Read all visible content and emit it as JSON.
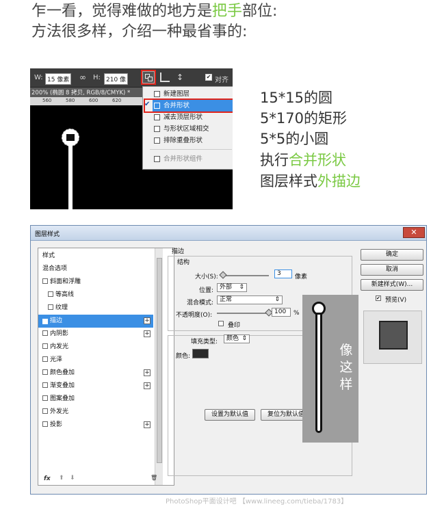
{
  "intro": {
    "line1_prefix": "乍一看，觉得难做的地方是",
    "line1_highlight": "把手",
    "line1_suffix": "部位:",
    "line2": "方法很多样，介绍一种最省事的:"
  },
  "ps_screenshot": {
    "toolbar": {
      "w_label": "W:",
      "w_value": "15 像素",
      "h_label": "H:",
      "h_value": "210 像",
      "link_glyph": "∞",
      "align_label": "对齐"
    },
    "tab_title": "200% (椭圆 8 拷贝, RGB/8/CMYK) *",
    "ruler_numbers": [
      "560",
      "580",
      "600",
      "620"
    ],
    "menu_items": [
      {
        "label": "新建图层",
        "state": "normal"
      },
      {
        "label": "合并形状",
        "state": "selected"
      },
      {
        "label": "减去顶层形状",
        "state": "normal"
      },
      {
        "label": "与形状区域相交",
        "state": "normal"
      },
      {
        "label": "排除重叠形状",
        "state": "normal"
      },
      {
        "label": "合并形状组件",
        "state": "disabled"
      }
    ],
    "check_glyph": "✔"
  },
  "steps": {
    "s1": "15*15的圆",
    "s2": "5*170的矩形",
    "s3": "5*5的小圆",
    "s4_prefix": "执行",
    "s4_highlight": "合并形状",
    "s5_prefix": "图层样式",
    "s5_highlight": "外描边"
  },
  "dialog": {
    "title": "图层样式",
    "close_glyph": "✕",
    "styles_list": [
      {
        "label": "样式",
        "checkbox": false,
        "plus": false,
        "indent": false,
        "selected": false
      },
      {
        "label": "混合选项",
        "checkbox": false,
        "plus": false,
        "indent": false,
        "selected": false
      },
      {
        "label": "斜面和浮雕",
        "checkbox": true,
        "plus": false,
        "indent": false,
        "selected": false
      },
      {
        "label": "等高线",
        "checkbox": true,
        "plus": false,
        "indent": true,
        "selected": false
      },
      {
        "label": "纹理",
        "checkbox": true,
        "plus": false,
        "indent": true,
        "selected": false
      },
      {
        "label": "描边",
        "checkbox": true,
        "plus": true,
        "indent": false,
        "selected": true
      },
      {
        "label": "内阴影",
        "checkbox": true,
        "plus": true,
        "indent": false,
        "selected": false
      },
      {
        "label": "内发光",
        "checkbox": true,
        "plus": false,
        "indent": false,
        "selected": false
      },
      {
        "label": "光泽",
        "checkbox": true,
        "plus": false,
        "indent": false,
        "selected": false
      },
      {
        "label": "颜色叠加",
        "checkbox": true,
        "plus": true,
        "indent": false,
        "selected": false
      },
      {
        "label": "渐变叠加",
        "checkbox": true,
        "plus": true,
        "indent": false,
        "selected": false
      },
      {
        "label": "图案叠加",
        "checkbox": true,
        "plus": false,
        "indent": false,
        "selected": false
      },
      {
        "label": "外发光",
        "checkbox": true,
        "plus": false,
        "indent": false,
        "selected": false
      },
      {
        "label": "投影",
        "checkbox": true,
        "plus": true,
        "indent": false,
        "selected": false
      }
    ],
    "footer": {
      "fx": "fx",
      "up": "⬆",
      "down": "⬇",
      "trash": "🗑"
    },
    "stroke": {
      "section_title": "描边",
      "group_title": "结构",
      "size_label": "大小(S):",
      "size_value": "3",
      "size_unit": "像素",
      "size_level": 0.02,
      "position_label": "位置:",
      "position_value": "外部",
      "blend_label": "混合模式:",
      "blend_value": "正常",
      "opacity_label": "不透明度(O):",
      "opacity_value": "100",
      "opacity_unit": "%",
      "opacity_level": 1.0,
      "overprint_label": "叠印",
      "fill_type_label": "填充类型:",
      "fill_type_value": "颜色",
      "color_label": "颜色:",
      "color_swatch": "#2b2b2b",
      "btn_default": "设置为默认值",
      "btn_reset": "复位为默认值"
    },
    "right_buttons": {
      "ok": "确定",
      "cancel": "取消",
      "new_style": "新建样式(W)...",
      "preview": "预览(V)",
      "preview_checked": true
    },
    "overlay_text": "像这样"
  },
  "watermark": "PhotoShop平面设计吧 【www.lineeg.com/tieba/1783】",
  "colors": {
    "accent_green": "#7ac943",
    "selection_blue": "#3b8fe4",
    "highlight_red": "#e0241b",
    "overlay_gray": "#9e9e9e"
  }
}
